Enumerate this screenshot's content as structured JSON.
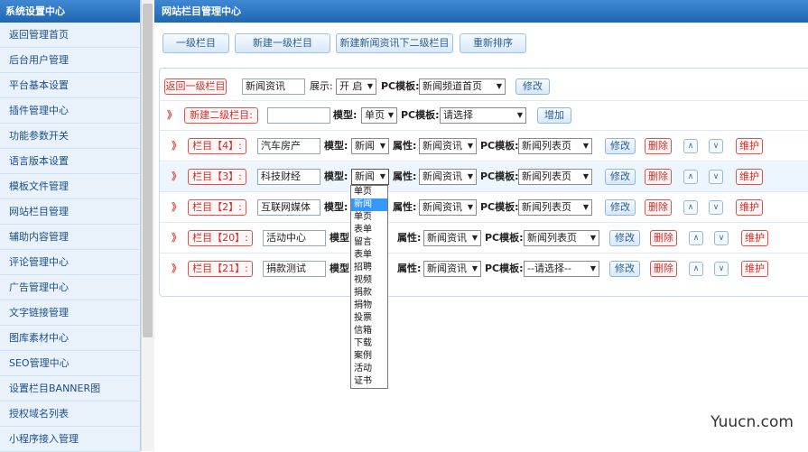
{
  "sidebar": {
    "title": "系统设置中心",
    "items": [
      "返回管理首页",
      "后台用户管理",
      "平台基本设置",
      "插件管理中心",
      "功能参数开关",
      "语言版本设置",
      "模板文件管理",
      "网站栏目管理",
      "辅助内容管理",
      "评论管理中心",
      "广告管理中心",
      "文字链接管理",
      "图库素材中心",
      "SEO管理中心",
      "设置栏目BANNER图",
      "授权域名列表",
      "小程序接入管理"
    ]
  },
  "main": {
    "title": "网站栏目管理中心",
    "toolbar": [
      "一级栏目",
      "新建一级栏目",
      "新建新闻资讯下二级栏目",
      "重新排序"
    ]
  },
  "top_row": {
    "back_button": "返回一级栏目",
    "name_value": "新闻资讯",
    "display_label": "展示:",
    "display_value": "开 启",
    "pc_label": "PC模板:",
    "pc_value": "新闻频道首页",
    "edit_button": "修改"
  },
  "new_row": {
    "chevron": "》",
    "button": "新建二级栏目:",
    "model_label": "模型:",
    "model_value": "单页",
    "pc_label": "PC模板:",
    "pc_value": "请选择",
    "add_button": "增加"
  },
  "labels": {
    "model": "模型:",
    "attr": "属性:",
    "pc": "PC模板:",
    "edit": "修改",
    "delete": "删除",
    "up": "∧",
    "down": "∨",
    "maintain": "维护",
    "chevron": "》"
  },
  "rows": [
    {
      "tag": "栏目【4】:",
      "name": "汽车房产",
      "model": "新闻",
      "attr": "新闻资讯",
      "pc": "新闻列表页"
    },
    {
      "tag": "栏目【3】:",
      "name": "科技财经",
      "model": "新闻",
      "attr": "新闻资讯",
      "pc": "新闻列表页"
    },
    {
      "tag": "栏目【2】:",
      "name": "互联网媒体",
      "model": "新闻",
      "attr": "新闻资讯",
      "pc": "新闻列表页"
    },
    {
      "tag": "栏目【20】:",
      "name": "活动中心",
      "model": "",
      "attr": "新闻资讯",
      "pc": "新闻列表页"
    },
    {
      "tag": "栏目【21】:",
      "name": "捐款测试",
      "model": "",
      "attr": "新闻资讯",
      "pc": "--请选择--"
    }
  ],
  "dropdown_options": [
    "单页",
    "新闻",
    "单页",
    "表单",
    "留言",
    "表单",
    "招聘",
    "视频",
    "捐款",
    "捐物",
    "投票",
    "信箱",
    "下载",
    "案例",
    "活动",
    "证书"
  ],
  "watermark": "Yuucn.com"
}
